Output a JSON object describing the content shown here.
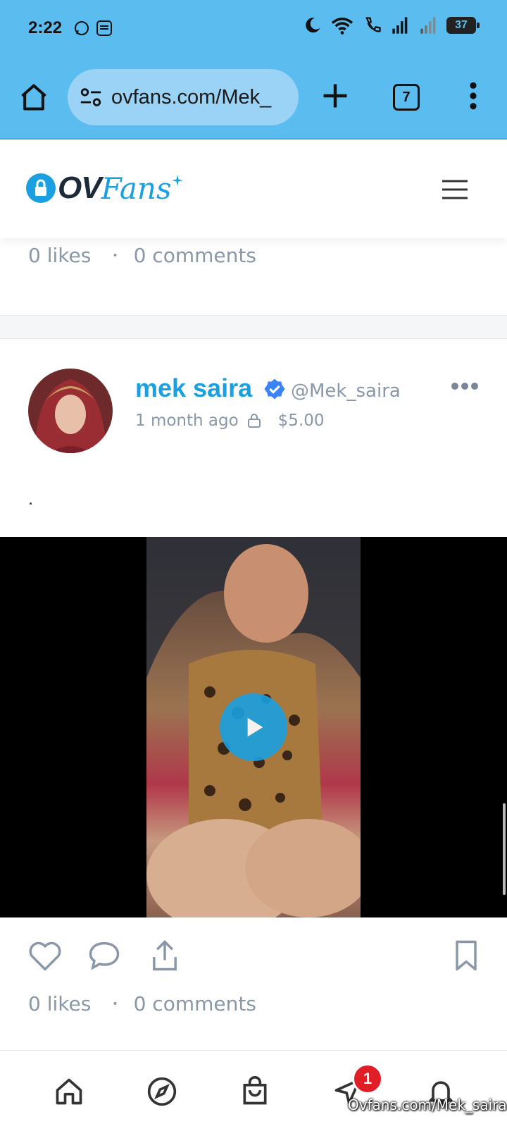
{
  "status_bar": {
    "time": "2:22",
    "battery": "37"
  },
  "browser": {
    "url": "ovfans.com/Mek_",
    "tab_count": "7"
  },
  "site": {
    "logo_text_ov": "OV",
    "logo_text_fans": "Fans"
  },
  "prev_post": {
    "likes": "0 likes",
    "comments": "0 comments"
  },
  "post": {
    "name": "mek saira",
    "handle": "@Mek_saira",
    "time_ago": "1 month ago",
    "price": "$5.00",
    "caption": ".",
    "likes": "0 likes",
    "comments": "0 comments"
  },
  "bottom_nav": {
    "messages_badge": "1"
  },
  "watermark": "Ovfans.com/Mek_saira",
  "colors": {
    "accent": "#1aa0e0",
    "browser_bar": "#5bbcf0",
    "muted": "#8a97a8",
    "badge": "#e01e28"
  }
}
